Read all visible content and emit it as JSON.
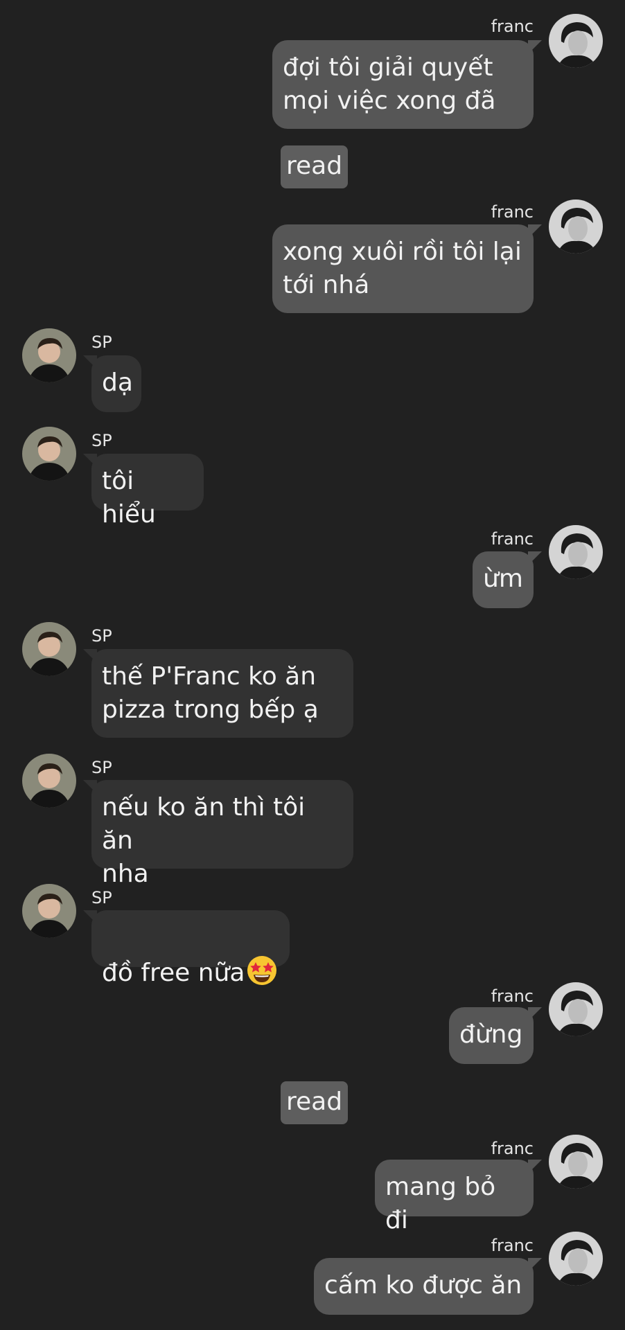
{
  "users": {
    "franc": "franc",
    "sp": "SP"
  },
  "status": {
    "read": "read"
  },
  "messages": [
    {
      "from": "franc",
      "text": "đợi tôi giải quyết\nmọi việc xong đã"
    },
    {
      "from": "franc",
      "text": "xong xuôi rồi tôi lại\ntới nhá"
    },
    {
      "from": "SP",
      "text": "dạ"
    },
    {
      "from": "SP",
      "text": "tôi hiểu"
    },
    {
      "from": "franc",
      "text": "ừm"
    },
    {
      "from": "SP",
      "text": "thế P'Franc ko ăn\npizza trong bếp ạ"
    },
    {
      "from": "SP",
      "text": "nếu ko ăn thì tôi ăn\nnha"
    },
    {
      "from": "SP",
      "text": "đồ free nữa",
      "emoji": "star-struck-emoji"
    },
    {
      "from": "franc",
      "text": "đừng"
    },
    {
      "from": "franc",
      "text": "mang bỏ đi"
    },
    {
      "from": "franc",
      "text": "cấm ko được ăn"
    }
  ],
  "colors": {
    "background": "#212121",
    "outgoing_bubble": "#565656",
    "incoming_bubble": "#323232",
    "read_badge": "#5e5e5e",
    "text": "#f2f2f2"
  }
}
